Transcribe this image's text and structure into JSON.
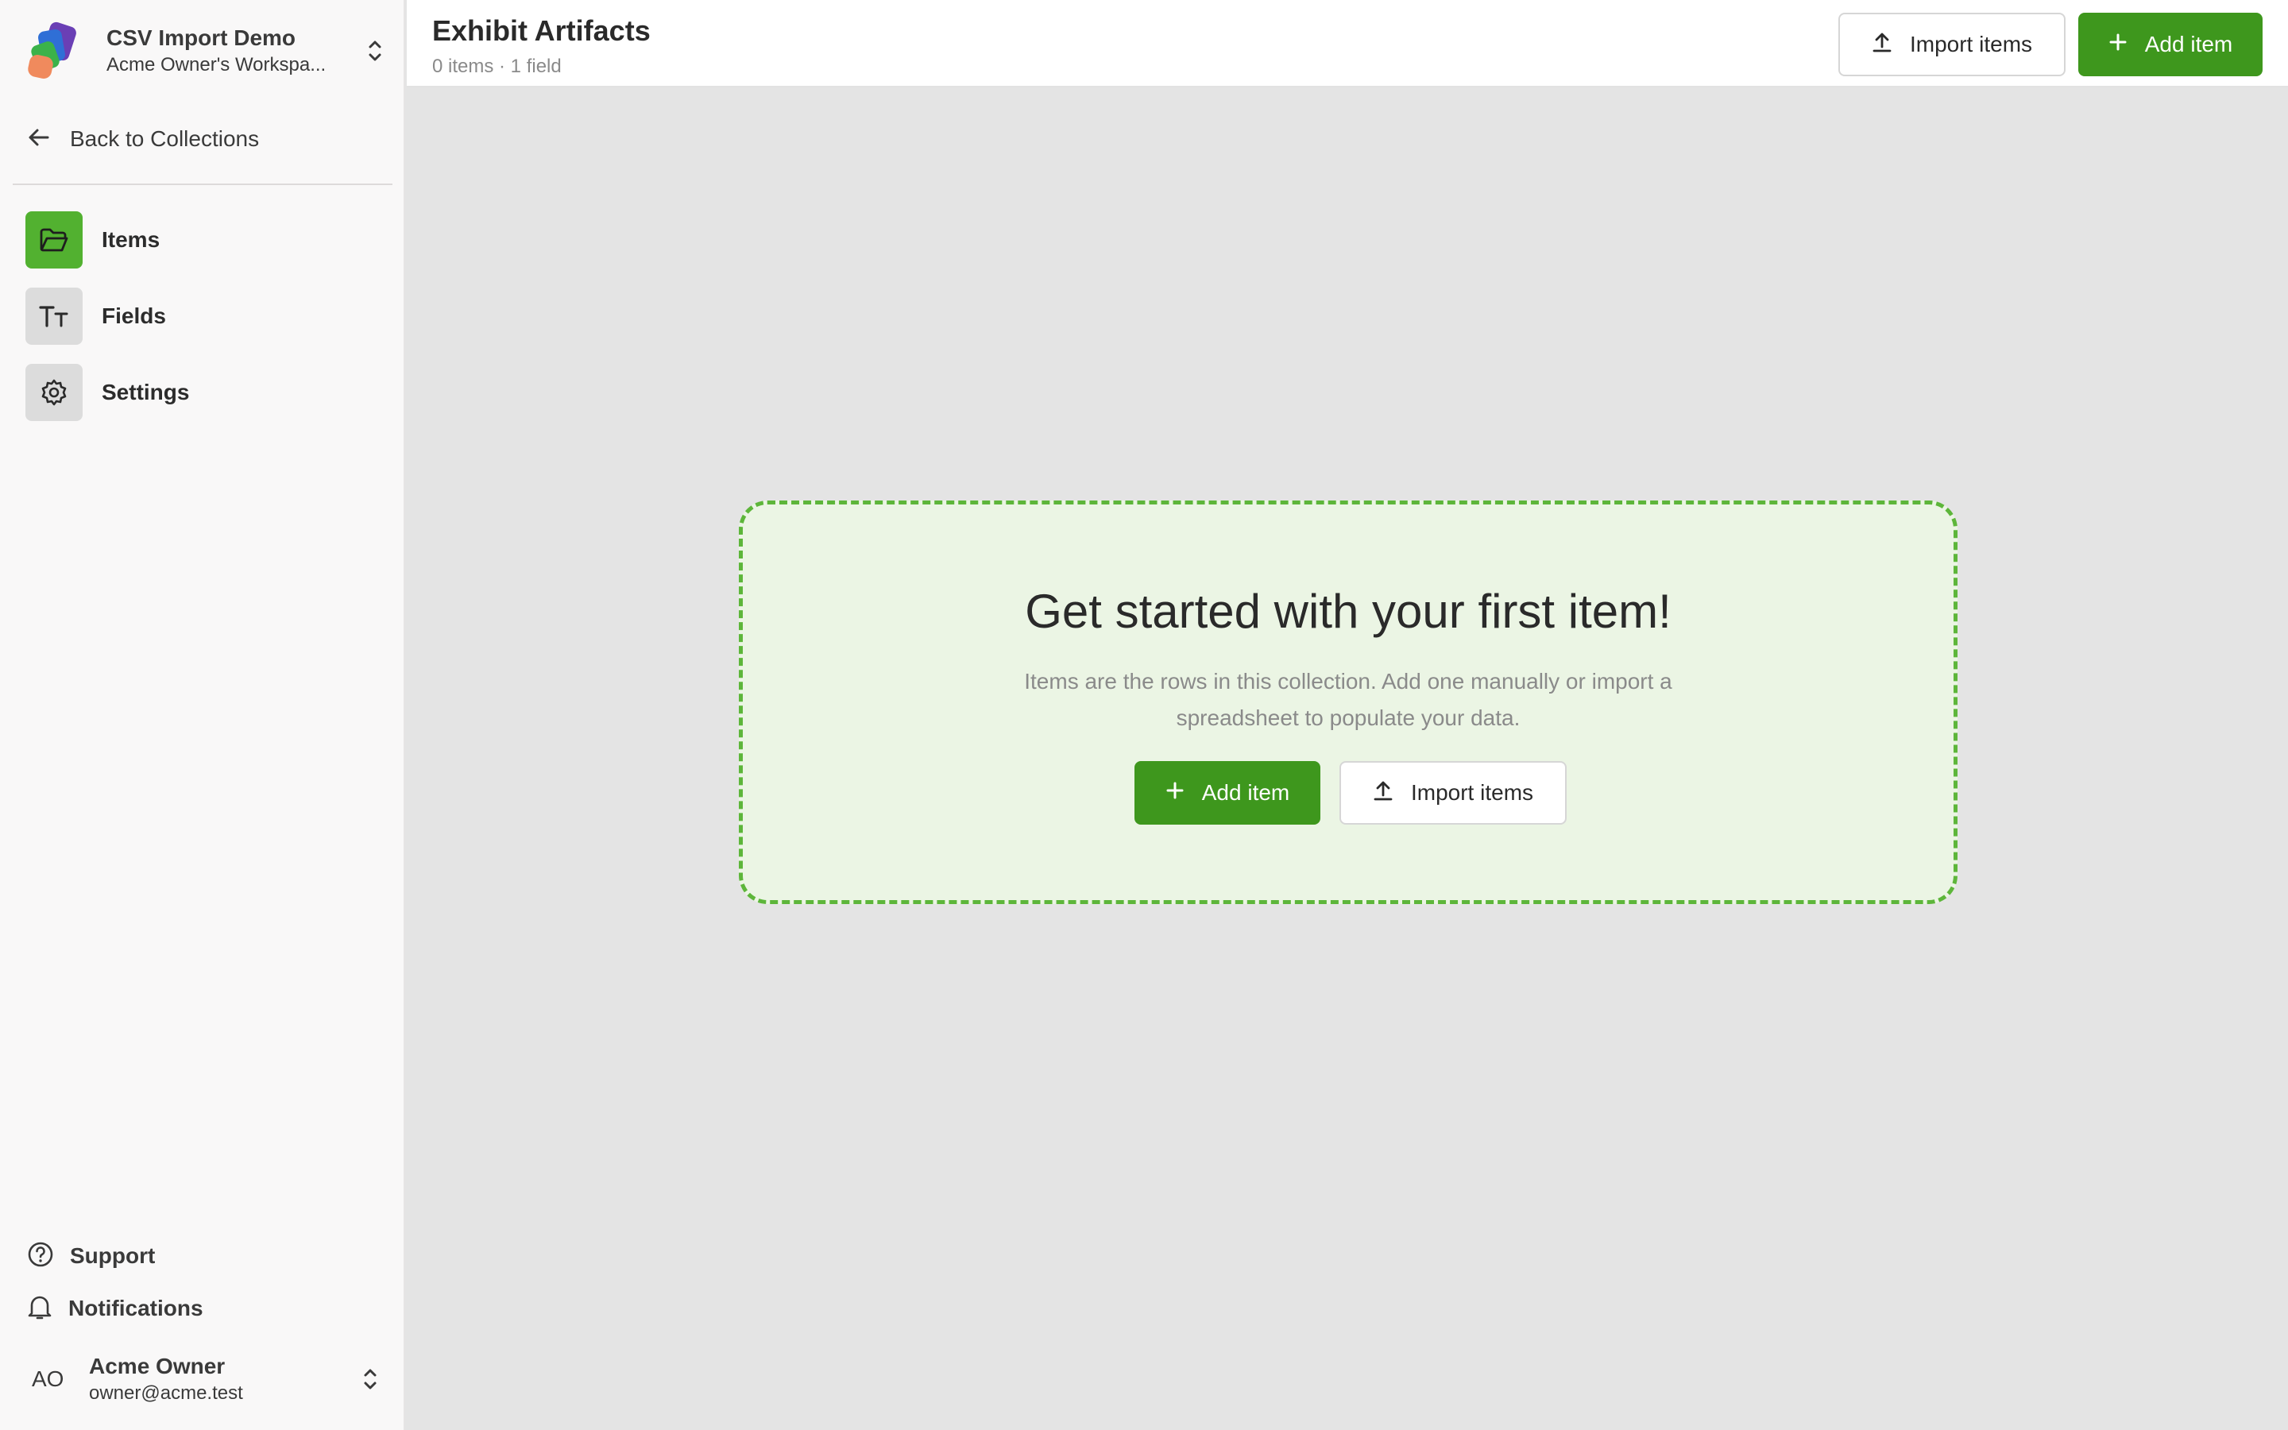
{
  "workspace": {
    "name": "CSV Import Demo",
    "subtitle": "Acme Owner's Workspa..."
  },
  "sidebar": {
    "back_label": "Back to Collections",
    "items": [
      {
        "label": "Items",
        "icon": "folder-icon",
        "active": true
      },
      {
        "label": "Fields",
        "icon": "text-type-icon",
        "active": false
      },
      {
        "label": "Settings",
        "icon": "gear-icon",
        "active": false
      }
    ],
    "footer": {
      "support": "Support",
      "notifications": "Notifications"
    },
    "user": {
      "initials": "AO",
      "name": "Acme Owner",
      "email": "owner@acme.test"
    }
  },
  "header": {
    "title": "Exhibit Artifacts",
    "meta": "0 items · 1 field",
    "import_label": "Import items",
    "add_label": "Add item"
  },
  "empty_state": {
    "title": "Get started with your first item!",
    "description": "Items are the rows in this collection. Add one manually or import a spreadsheet to populate your data.",
    "add_label": "Add item",
    "import_label": "Import items"
  },
  "colors": {
    "accent": "#3e971d",
    "accent_light": "#52b130",
    "empty_bg": "#ebf5e4",
    "empty_border": "#5db63a",
    "canvas": "#e4e4e4"
  }
}
